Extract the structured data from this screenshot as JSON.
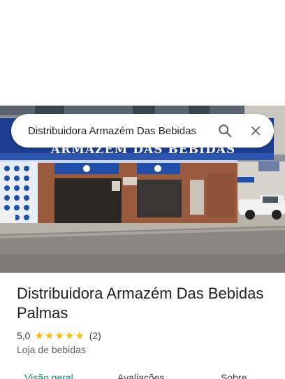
{
  "search": {
    "query": "Distribuidora Armazém Das Bebidas"
  },
  "photo": {
    "storefront_sign": "ARMAZÉM DAS BEBIDAS"
  },
  "place": {
    "title": "Distribuidora Armazém Das Bebidas Palmas",
    "rating": "5,0",
    "stars": 5,
    "review_count": "(2)",
    "category": "Loja de bebidas"
  },
  "tabs": [
    {
      "label": "Visão geral",
      "active": true
    },
    {
      "label": "Avaliações",
      "active": false
    },
    {
      "label": "Sobre",
      "active": false
    }
  ],
  "colors": {
    "accent": "#0b8a82",
    "star": "#fbbc04"
  },
  "icons": [
    "search-icon",
    "close-icon",
    "star-icon"
  ]
}
